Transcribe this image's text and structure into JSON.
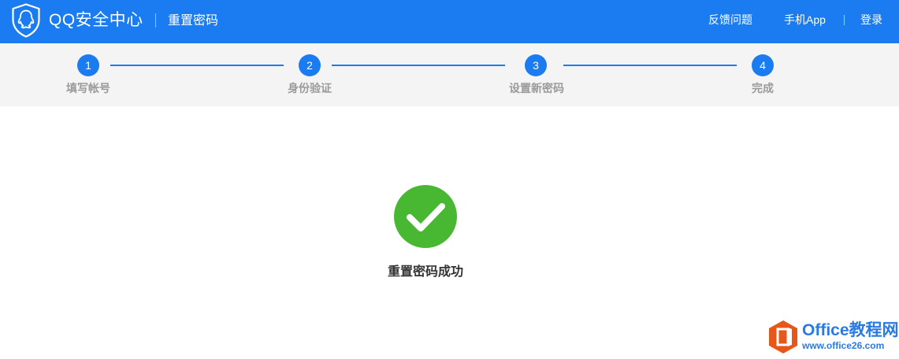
{
  "header": {
    "brand": "QQ安全中心",
    "page_name": "重置密码",
    "nav": {
      "feedback": "反馈问题",
      "app": "手机App",
      "login": "登录"
    },
    "color": "#1a7cf0"
  },
  "steps": [
    {
      "number": "1",
      "label": "填写帐号"
    },
    {
      "number": "2",
      "label": "身份验证"
    },
    {
      "number": "3",
      "label": "设置新密码"
    },
    {
      "number": "4",
      "label": "完成"
    }
  ],
  "result": {
    "message": "重置密码成功",
    "icon": "checkmark-circle-icon",
    "color": "#48b832"
  },
  "watermark": {
    "title": "Office教程网",
    "url": "www.office26.com",
    "icon": "office-logo-icon",
    "color": "#e8571a"
  }
}
